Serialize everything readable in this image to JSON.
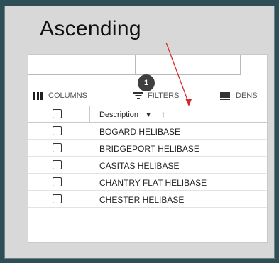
{
  "caption": "Ascending",
  "toolbar": {
    "columns_label": "COLUMNS",
    "filters_label": "FILTERS",
    "density_label": "DENS",
    "filter_badge": "1"
  },
  "grid": {
    "header": {
      "description_label": "Description",
      "filter_icon": "▼",
      "sort_icon": "↑"
    },
    "rows": [
      "BOGARD HELIBASE",
      "BRIDGEPORT HELIBASE",
      "CASITAS HELIBASE",
      "CHANTRY FLAT HELIBASE",
      "CHESTER HELIBASE"
    ]
  },
  "colors": {
    "annotation_arrow": "#d62a2a",
    "background": "#2f4f56",
    "slide": "#d8d8d8",
    "badge": "#3f3f3f"
  }
}
